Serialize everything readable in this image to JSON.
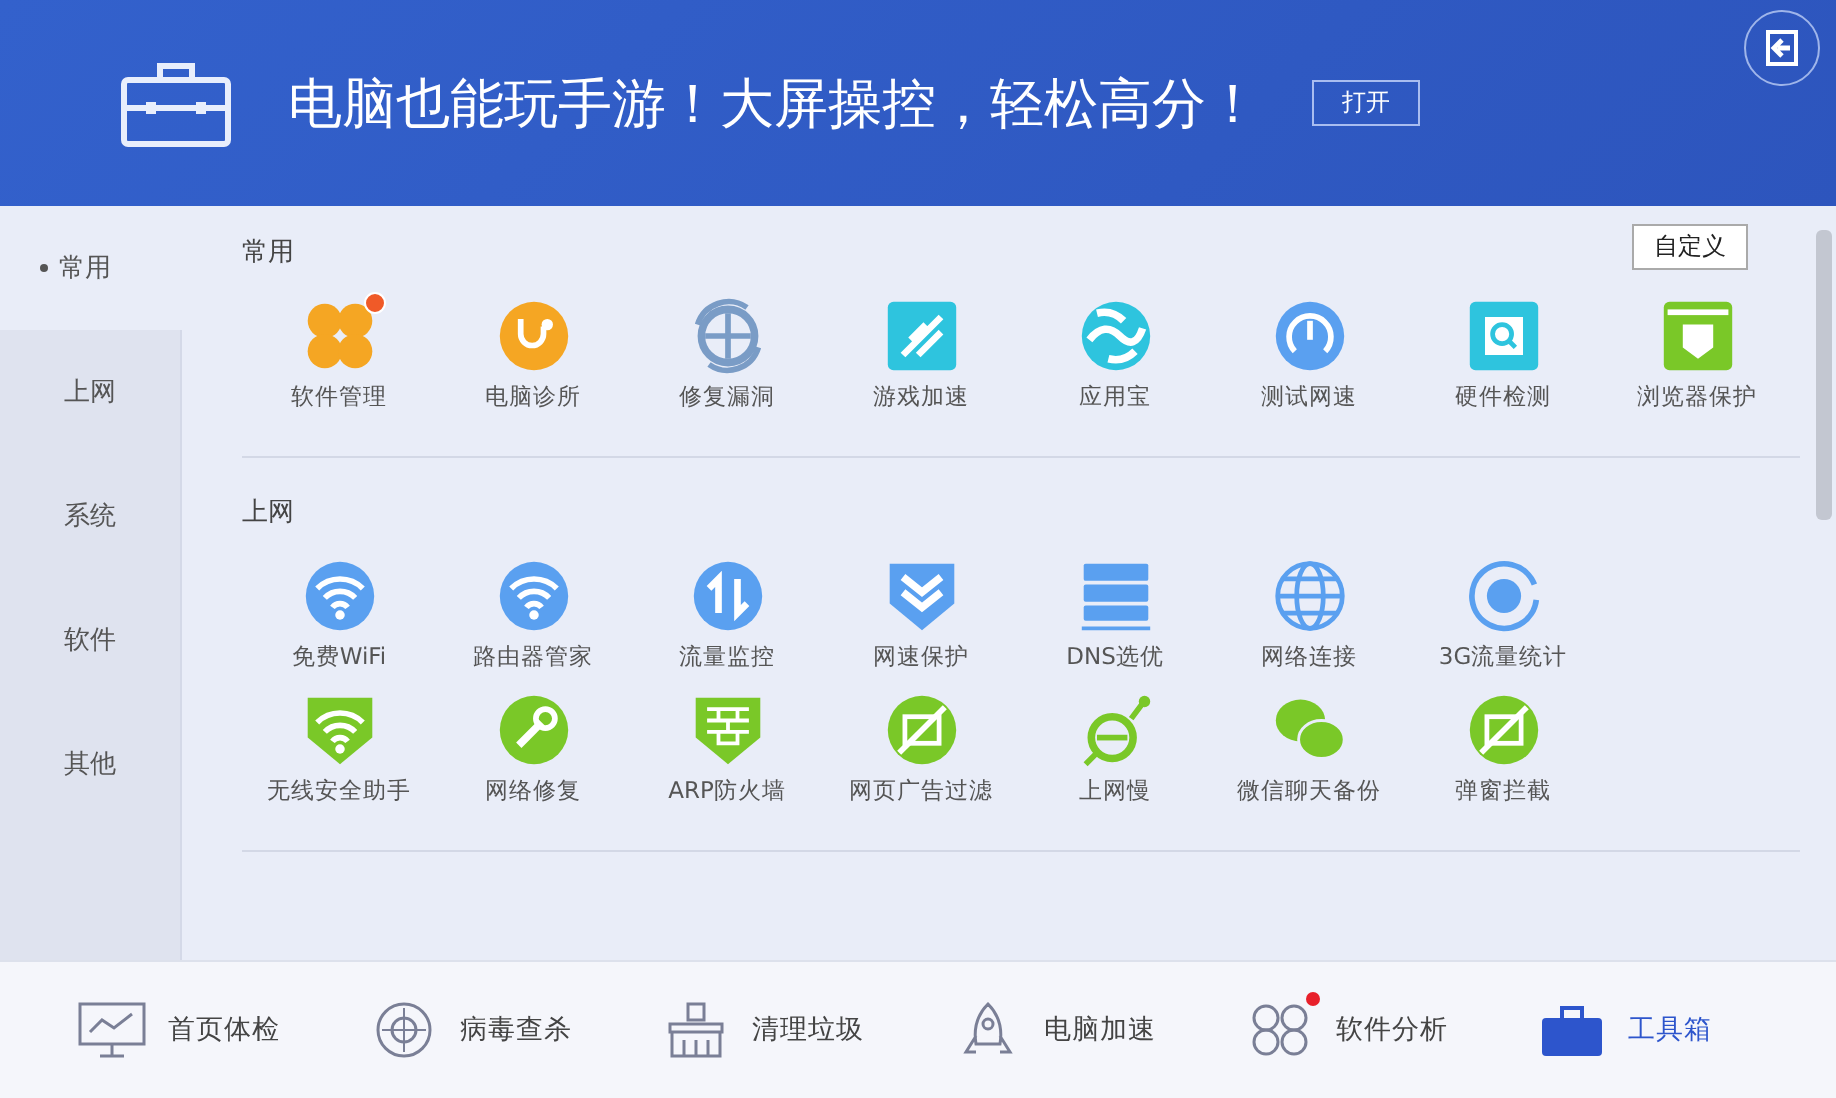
{
  "banner": {
    "headline": "电脑也能玩手游！大屏操控，轻松高分！",
    "open_button": "打开"
  },
  "sidebar": {
    "items": [
      {
        "label": "常用",
        "selected": true
      },
      {
        "label": "上网",
        "selected": false
      },
      {
        "label": "系统",
        "selected": false
      },
      {
        "label": "软件",
        "selected": false
      },
      {
        "label": "其他",
        "selected": false
      }
    ]
  },
  "customize_button": "自定义",
  "sections": [
    {
      "title": "常用",
      "rows": [
        [
          {
            "label": "软件管理",
            "badge": true
          },
          {
            "label": "电脑诊所",
            "badge": false
          },
          {
            "label": "修复漏洞",
            "badge": false
          },
          {
            "label": "游戏加速",
            "badge": false
          },
          {
            "label": "应用宝",
            "badge": false
          },
          {
            "label": "测试网速",
            "badge": false
          },
          {
            "label": "硬件检测",
            "badge": false
          },
          {
            "label": "浏览器保护",
            "badge": false
          }
        ]
      ]
    },
    {
      "title": "上网",
      "rows": [
        [
          {
            "label": "免费WiFi",
            "badge": false
          },
          {
            "label": "路由器管家",
            "badge": false
          },
          {
            "label": "流量监控",
            "badge": false
          },
          {
            "label": "网速保护",
            "badge": false
          },
          {
            "label": "DNS选优",
            "badge": false
          },
          {
            "label": "网络连接",
            "badge": false
          },
          {
            "label": "3G流量统计",
            "badge": false
          }
        ],
        [
          {
            "label": "无线安全助手",
            "badge": false
          },
          {
            "label": "网络修复",
            "badge": false
          },
          {
            "label": "ARP防火墙",
            "badge": false
          },
          {
            "label": "网页广告过滤",
            "badge": false
          },
          {
            "label": "上网慢",
            "badge": false
          },
          {
            "label": "微信聊天备份",
            "badge": false
          },
          {
            "label": "弹窗拦截",
            "badge": false
          }
        ]
      ]
    }
  ],
  "bottom_nav": [
    {
      "label": "首页体检",
      "selected": false,
      "badge": false
    },
    {
      "label": "病毒查杀",
      "selected": false,
      "badge": false
    },
    {
      "label": "清理垃圾",
      "selected": false,
      "badge": false
    },
    {
      "label": "电脑加速",
      "selected": false,
      "badge": false
    },
    {
      "label": "软件分析",
      "selected": false,
      "badge": true
    },
    {
      "label": "工具箱",
      "selected": true,
      "badge": false
    }
  ]
}
